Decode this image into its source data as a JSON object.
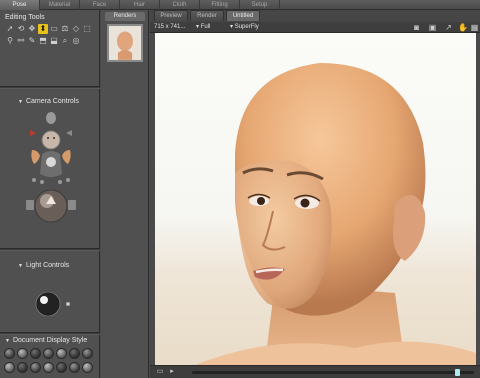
{
  "rooms": [
    "Pose",
    "Material",
    "Face",
    "Hair",
    "Cloth",
    "Fitting",
    "Setup"
  ],
  "left_panel": {
    "editing_title": "Editing Tools",
    "camera_title": "Camera Controls",
    "light_title": "Light Controls",
    "display_title": "Document Display Style"
  },
  "tools_row1": [
    "➚",
    "⟲",
    "✥",
    "⬍",
    "▭",
    "⚖",
    "◇",
    "⬚"
  ],
  "tools_row2": [
    "⚲",
    "⚯",
    "✎",
    "⬒",
    "⬓",
    "⌕",
    "◎",
    ""
  ],
  "active_tool_index": 3,
  "renders": {
    "tab_label": "Renders"
  },
  "view_tabs": [
    "Preview",
    "Render",
    "Untitled"
  ],
  "active_view_tab": 2,
  "view_toolbar": {
    "resolution": "715 x 741...",
    "size": "Full",
    "render_mode": "SuperFly"
  },
  "colors": {
    "panel": "#505050",
    "accent_active_tool": "#e7c21c",
    "timeline_marker": "#aeeaf2"
  },
  "timeline": {
    "position_fraction": 0.95
  },
  "icons": {
    "camera": "camera-icon",
    "snapshot": "snapshot-icon",
    "share": "share-icon",
    "hand": "hand-icon",
    "grid": "grid-icon"
  }
}
